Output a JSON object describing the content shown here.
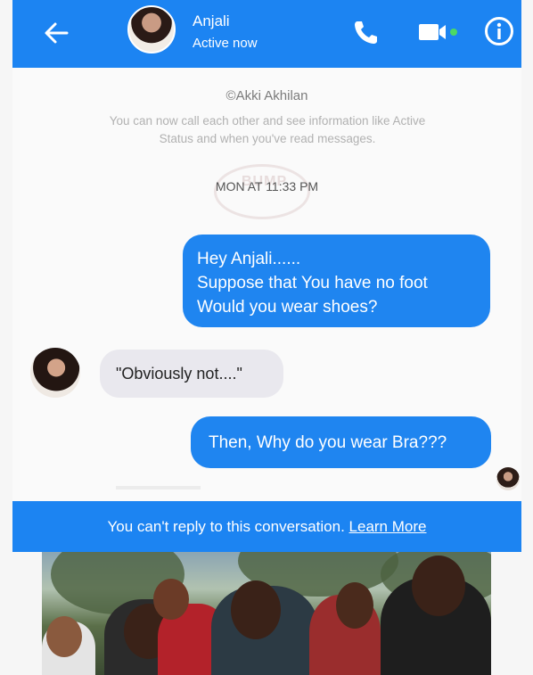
{
  "header": {
    "back_icon": "arrow-left-icon",
    "contact_name": "Anjali",
    "contact_status": "Active now",
    "call_icon": "phone-icon",
    "video_icon": "video-camera-icon",
    "info_icon": "info-icon"
  },
  "thread": {
    "credit": "©Akki Akhilan",
    "notice": "You can now call each other and see information like Active Status and when you've read messages.",
    "watermark": "BUMP",
    "timestamp": "MON AT 11:33 PM",
    "messages": [
      {
        "direction": "outgoing",
        "lines": [
          "Hey Anjali......",
          "Suppose that You have no foot",
          "Would you wear shoes?"
        ]
      },
      {
        "direction": "incoming",
        "text": "\"Obviously not....\""
      },
      {
        "direction": "outgoing",
        "text": "Then, Why do you wear Bra???"
      }
    ]
  },
  "banner": {
    "text": "You can't reply to this conversation.",
    "link": "Learn More"
  },
  "colors": {
    "brand_blue": "#1c84f2",
    "incoming_bubble": "#e9e8ee"
  }
}
